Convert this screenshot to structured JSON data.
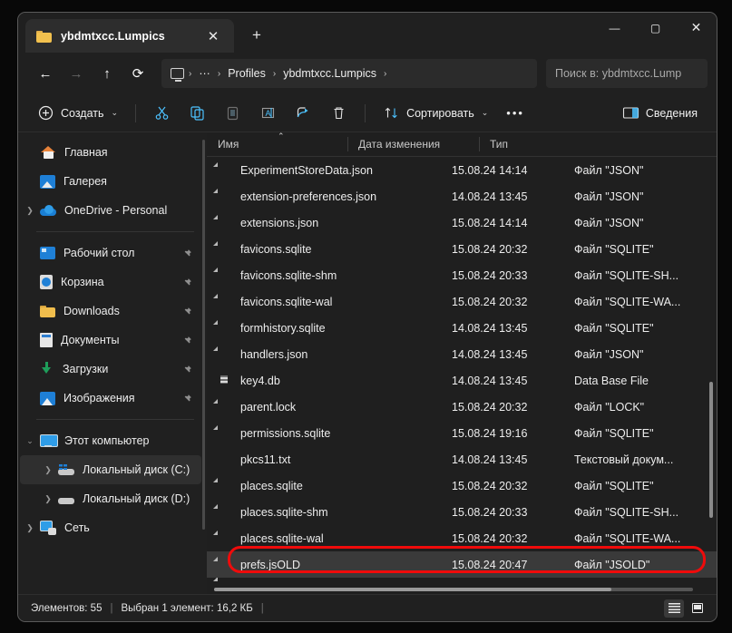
{
  "window": {
    "tab_title": "ybdmtxcc.Lumpics",
    "tab_close_label": "✕",
    "new_tab_label": "+",
    "minimize_label": "—",
    "maximize_label": "▢",
    "close_label": "✕"
  },
  "nav": {
    "back_label": "←",
    "forward_label": "→",
    "up_label": "↑",
    "refresh_label": "⟳",
    "breadcrumb": [
      {
        "type": "icon",
        "label": "monitor-icon"
      },
      {
        "type": "sep",
        "label": "›"
      },
      {
        "type": "crumb",
        "label": "···"
      },
      {
        "type": "sep",
        "label": "›"
      },
      {
        "type": "crumb",
        "label": "Profiles"
      },
      {
        "type": "sep",
        "label": "›"
      },
      {
        "type": "crumb",
        "label": "ybdmtxcc.Lumpics"
      },
      {
        "type": "sep",
        "label": "›"
      }
    ],
    "search_placeholder": "Поиск в: ybdmtxcc.Lump"
  },
  "toolbar": {
    "new_label": "Создать",
    "new_chevron": "⌄",
    "cut_label": "✂",
    "copy_label": "⧉",
    "paste_label": "📋",
    "rename_label": "A",
    "share_label": "↗",
    "delete_label": "🗑",
    "sort_label": "Сортировать",
    "sort_chevron": "⌄",
    "more_label": "•••",
    "details_label": "Сведения"
  },
  "sidebar": {
    "items": [
      {
        "label": "Главная",
        "icon": "home-icon",
        "expand": "",
        "pin": false,
        "indent": false,
        "highlight": false
      },
      {
        "label": "Галерея",
        "icon": "gallery-icon",
        "expand": "",
        "pin": false,
        "indent": false,
        "highlight": false
      },
      {
        "label": "OneDrive - Personal",
        "icon": "cloud-icon",
        "expand": "›",
        "pin": false,
        "indent": false,
        "highlight": false
      },
      {
        "label": "Рабочий стол",
        "icon": "desktop-icon",
        "expand": "",
        "pin": true,
        "indent": false,
        "highlight": false
      },
      {
        "label": "Корзина",
        "icon": "recycle-bin-icon",
        "expand": "",
        "pin": true,
        "indent": false,
        "highlight": false
      },
      {
        "label": "Downloads",
        "icon": "folder-icon",
        "expand": "",
        "pin": true,
        "indent": false,
        "highlight": false
      },
      {
        "label": "Документы",
        "icon": "documents-icon",
        "expand": "",
        "pin": true,
        "indent": false,
        "highlight": false
      },
      {
        "label": "Загрузки",
        "icon": "downloads-icon",
        "expand": "",
        "pin": true,
        "indent": false,
        "highlight": false
      },
      {
        "label": "Изображения",
        "icon": "pictures-icon",
        "expand": "",
        "pin": true,
        "indent": false,
        "highlight": false
      },
      {
        "label": "Этот компьютер",
        "icon": "this-pc-icon",
        "expand": "⌄",
        "pin": false,
        "indent": false,
        "highlight": false
      },
      {
        "label": "Локальный диск (C:)",
        "icon": "system-drive-icon",
        "expand": "›",
        "pin": false,
        "indent": true,
        "highlight": true
      },
      {
        "label": "Локальный диск (D:)",
        "icon": "drive-icon",
        "expand": "›",
        "pin": false,
        "indent": true,
        "highlight": false
      },
      {
        "label": "Сеть",
        "icon": "network-icon",
        "expand": "›",
        "pin": false,
        "indent": false,
        "highlight": false
      }
    ],
    "pin_glyph": "📌"
  },
  "columns": {
    "name": "Имя",
    "date": "Дата изменения",
    "type": "Тип",
    "sort_arrow": "⌃"
  },
  "files": [
    {
      "name": "ExperimentStoreData.json",
      "date": "15.08.24 14:14",
      "type": "Файл \"JSON\"",
      "icon": "file-icon",
      "selected": false
    },
    {
      "name": "extension-preferences.json",
      "date": "14.08.24 13:45",
      "type": "Файл \"JSON\"",
      "icon": "file-icon",
      "selected": false
    },
    {
      "name": "extensions.json",
      "date": "15.08.24 14:14",
      "type": "Файл \"JSON\"",
      "icon": "file-icon",
      "selected": false
    },
    {
      "name": "favicons.sqlite",
      "date": "15.08.24 20:32",
      "type": "Файл \"SQLITE\"",
      "icon": "file-icon",
      "selected": false
    },
    {
      "name": "favicons.sqlite-shm",
      "date": "15.08.24 20:33",
      "type": "Файл \"SQLITE-SH...",
      "icon": "file-icon",
      "selected": false
    },
    {
      "name": "favicons.sqlite-wal",
      "date": "15.08.24 20:32",
      "type": "Файл \"SQLITE-WA...",
      "icon": "file-icon",
      "selected": false
    },
    {
      "name": "formhistory.sqlite",
      "date": "14.08.24 13:45",
      "type": "Файл \"SQLITE\"",
      "icon": "file-icon",
      "selected": false
    },
    {
      "name": "handlers.json",
      "date": "14.08.24 13:45",
      "type": "Файл \"JSON\"",
      "icon": "file-icon",
      "selected": false
    },
    {
      "name": "key4.db",
      "date": "14.08.24 13:45",
      "type": "Data Base File",
      "icon": "database-icon",
      "selected": false
    },
    {
      "name": "parent.lock",
      "date": "15.08.24 20:32",
      "type": "Файл \"LOCK\"",
      "icon": "file-icon",
      "selected": false
    },
    {
      "name": "permissions.sqlite",
      "date": "15.08.24 19:16",
      "type": "Файл \"SQLITE\"",
      "icon": "file-icon",
      "selected": false
    },
    {
      "name": "pkcs11.txt",
      "date": "14.08.24 13:45",
      "type": "Текстовый докум...",
      "icon": "text-file-icon",
      "selected": false
    },
    {
      "name": "places.sqlite",
      "date": "15.08.24 20:32",
      "type": "Файл \"SQLITE\"",
      "icon": "file-icon",
      "selected": false
    },
    {
      "name": "places.sqlite-shm",
      "date": "15.08.24 20:33",
      "type": "Файл \"SQLITE-SH...",
      "icon": "file-icon",
      "selected": false
    },
    {
      "name": "places.sqlite-wal",
      "date": "15.08.24 20:32",
      "type": "Файл \"SQLITE-WA...",
      "icon": "file-icon",
      "selected": false
    },
    {
      "name": "prefs.jsOLD",
      "date": "15.08.24 20:47",
      "type": "Файл \"JSOLD\"",
      "icon": "file-icon",
      "selected": true
    }
  ],
  "status": {
    "count_label": "Элементов: 55",
    "separator": "|",
    "selection_label": "Выбран 1 элемент: 16,2 КБ",
    "trailing_separator": "|"
  },
  "view_toggles": {
    "details_label": "details-view",
    "large_icons_label": "large-icons-view"
  },
  "annotation": {
    "color": "#ef0b0b"
  }
}
